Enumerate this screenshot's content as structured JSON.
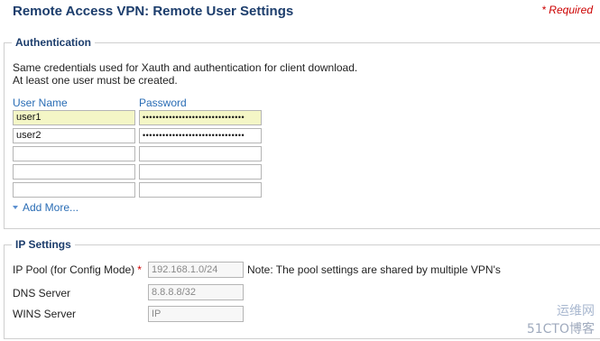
{
  "header": {
    "title": "Remote Access VPN: Remote User Settings",
    "required": "* Required"
  },
  "authentication": {
    "legend": "Authentication",
    "description_line1": "Same credentials used for Xauth and authentication for client download.",
    "description_line2": "At least one user must be created.",
    "col_user": "User Name",
    "col_password": "Password",
    "rows": [
      {
        "user": "user1",
        "password": "•••••••••••••••••••••••••••••••"
      },
      {
        "user": "user2",
        "password": "•••••••••••••••••••••••••••••••"
      },
      {
        "user": "",
        "password": ""
      },
      {
        "user": "",
        "password": ""
      },
      {
        "user": "",
        "password": ""
      }
    ],
    "add_more": "Add More..."
  },
  "ip_settings": {
    "legend": "IP Settings",
    "ip_pool_label": "IP Pool (for Config Mode)",
    "ip_pool_required": "*",
    "ip_pool_placeholder": "192.168.1.0/24",
    "ip_pool_note": "Note: The pool settings are shared by multiple VPN's",
    "dns_label": "DNS Server",
    "dns_placeholder": "8.8.8.8/32",
    "wins_label": "WINS Server",
    "wins_placeholder": "IP"
  },
  "watermark": {
    "line1": "运维网",
    "line2": "51CTO博客"
  },
  "colors": {
    "title": "#1c3d6c",
    "link": "#2a6db5",
    "required": "#cc0000",
    "filled_input": "#f4f6c6"
  }
}
